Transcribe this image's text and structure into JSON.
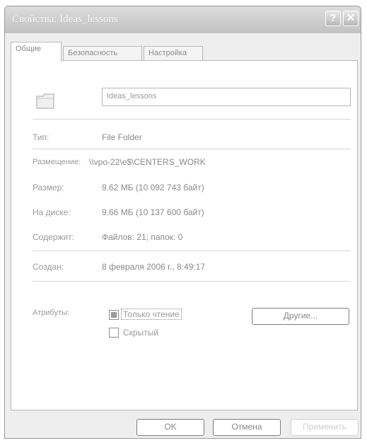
{
  "window": {
    "title": "Свойства: Ideas_lessons"
  },
  "tabs": [
    {
      "label": "Общие"
    },
    {
      "label": "Безопасность"
    },
    {
      "label": "Настройка"
    }
  ],
  "general": {
    "name_value": "Ideas_lessons",
    "type_label": "Тип:",
    "type_value": "File Folder",
    "location_label": "Размещение:",
    "location_value": "\\\\vpo-22\\e$\\CENTERS_WORK",
    "size_label": "Размер:",
    "size_value": "9.62 МБ (10 092 743 байт)",
    "disk_label": "На диске:",
    "disk_value": "9.66 МБ (10 137 600 байт)",
    "contains_label": "Содержит:",
    "contains_value": "Файлов: 21; папок: 0",
    "created_label": "Создан:",
    "created_value": "8 февраля 2006 г., 8:49:17",
    "attributes_label": "Атрибуты:",
    "readonly_label": "Только чтение",
    "hidden_label": "Скрытый",
    "other_button": "Другие..."
  },
  "buttons": {
    "ok": "OK",
    "cancel": "Отмена",
    "apply": "Применить"
  },
  "icons": {
    "help": "question-icon",
    "close": "close-icon",
    "folder": "folder-icon"
  }
}
